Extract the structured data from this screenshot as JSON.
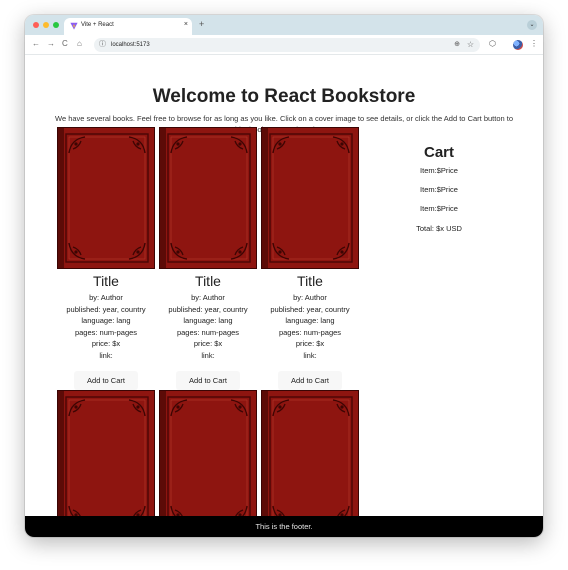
{
  "browser": {
    "tab_title": "Vite + React",
    "tab_close": "×",
    "new_tab": "+",
    "tab_menu": "⌄",
    "url": "localhost:5173",
    "nav": {
      "back": "←",
      "forward": "→",
      "reload": "C",
      "home": "⌂"
    },
    "icons": {
      "info": "ⓘ",
      "zoom": "⊕",
      "star": "☆",
      "extensions": "⬡",
      "menu": "⋮"
    }
  },
  "page": {
    "title": "Welcome to React Bookstore",
    "intro": "We have several books. Feel free to browse for as long as you like. Click on a cover image to see details, or click the Add to Cart button to add a book to your shopping cart."
  },
  "books": [
    {
      "title": "Title",
      "author": "by: Author",
      "published": "published: year, country",
      "language": "language: lang",
      "pages": "pages: num-pages",
      "price": "price: $x",
      "link": "link:",
      "button": "Add to Cart"
    },
    {
      "title": "Title",
      "author": "by: Author",
      "published": "published: year, country",
      "language": "language: lang",
      "pages": "pages: num-pages",
      "price": "price: $x",
      "link": "link:",
      "button": "Add to Cart"
    },
    {
      "title": "Title",
      "author": "by: Author",
      "published": "published: year, country",
      "language": "language: lang",
      "pages": "pages: num-pages",
      "price": "price: $x",
      "link": "link:",
      "button": "Add to Cart"
    },
    {
      "title": "",
      "button": ""
    },
    {
      "title": "",
      "button": ""
    },
    {
      "title": "",
      "button": ""
    }
  ],
  "cart": {
    "heading": "Cart",
    "items": [
      "Item:$Price",
      "Item:$Price",
      "Item:$Price"
    ],
    "total": "Total: $x USD"
  },
  "footer": {
    "text": "This is the footer."
  },
  "colors": {
    "tab_strip": "#d3e3ea",
    "cover_red": "#8e1510",
    "footer": "#000000"
  }
}
